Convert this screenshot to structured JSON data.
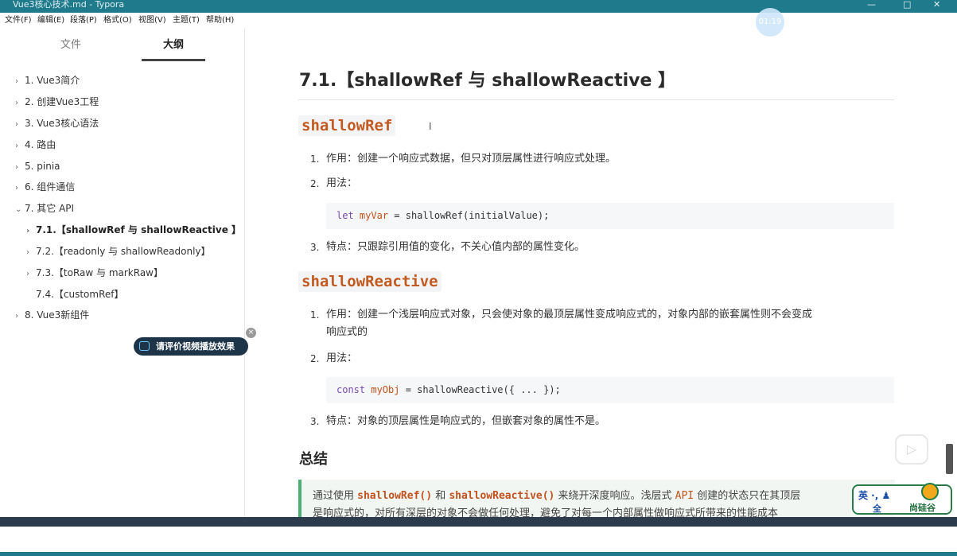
{
  "window": {
    "title": "Vue3核心技术.md - Typora",
    "controls": [
      "—",
      "□",
      "✕"
    ]
  },
  "menu": [
    "文件(F)",
    "编辑(E)",
    "段落(P)",
    "格式(O)",
    "视图(V)",
    "主题(T)",
    "帮助(H)"
  ],
  "sidebar": {
    "tabs": [
      {
        "label": "文件",
        "active": false
      },
      {
        "label": "大纲",
        "active": true
      }
    ],
    "outline": [
      {
        "label": "1. Vue3简介",
        "arrow": "›"
      },
      {
        "label": "2. 创建Vue3工程",
        "arrow": "›"
      },
      {
        "label": "3. Vue3核心语法",
        "arrow": "›"
      },
      {
        "label": "4. 路由",
        "arrow": "›"
      },
      {
        "label": "5. pinia",
        "arrow": "›"
      },
      {
        "label": "6. 组件通信",
        "arrow": "›"
      },
      {
        "label": "7. 其它 API",
        "arrow": "⌄"
      },
      {
        "label": "7.1.【shallowRef 与 shallowReactive 】",
        "arrow": "›"
      },
      {
        "label": "7.2.【readonly 与 shallowReadonly】",
        "arrow": "›"
      },
      {
        "label": "7.3.【toRaw 与 markRaw】",
        "arrow": "›"
      },
      {
        "label": "7.4.【customRef】",
        "arrow": ""
      },
      {
        "label": "8. Vue3新组件",
        "arrow": "›"
      }
    ],
    "eval_button": "请评价视频播放效果",
    "eval_close": "×"
  },
  "content": {
    "heading": "7.1.【shallowRef 与 shallowReactive 】",
    "section1": {
      "title": "shallowRef",
      "items": [
        {
          "num": "1.",
          "text": "作用：创建一个响应式数据，但只对顶层属性进行响应式处理。"
        },
        {
          "num": "2.",
          "text": "用法："
        },
        {
          "num": "3.",
          "text": "特点：只跟踪引用值的变化，不关心值内部的属性变化。"
        }
      ],
      "code": {
        "kw": "let",
        "var": "myVar",
        "rest": " = shallowRef(initialValue);"
      }
    },
    "section2": {
      "title": "shallowReactive",
      "items": [
        {
          "num": "1.",
          "line1": "作用：创建一个浅层响应式对象，只会使对象的最顶层属性变成响应式的，对象内部的嵌套属性则不会变成",
          "line2": "响应式的"
        },
        {
          "num": "2.",
          "text": "用法："
        },
        {
          "num": "3.",
          "text": "特点：对象的顶层属性是响应式的，但嵌套对象的属性不是。"
        }
      ],
      "code": {
        "kw": "const",
        "var": "myObj",
        "rest": " = shallowReactive({ ... });"
      }
    },
    "summary": {
      "title": "总结",
      "p1": "通过使用 ",
      "c1": "shallowRef()",
      "p2": " 和 ",
      "c2": "shallowReactive()",
      "p3": " 来绕开深度响应。浅层式 ",
      "c3": "API",
      "p4": " 创建的状态只在其顶层",
      "line2": "是响应式的，对所有深层的对象不会做任何处理，避免了对每一个内部属性做响应式所带来的性能成本"
    }
  },
  "overlays": {
    "timer": "01:19",
    "text_cursor": "I",
    "play_icon": "▷",
    "ime": {
      "line1": "英 ·, ♟",
      "line2": "全",
      "brand": "尚硅谷"
    }
  },
  "colors": {
    "accent": "#1f7a8c",
    "code_orange": "#c25a22",
    "quote_bar": "#4caf72",
    "eval_bg": "#1e3448"
  }
}
